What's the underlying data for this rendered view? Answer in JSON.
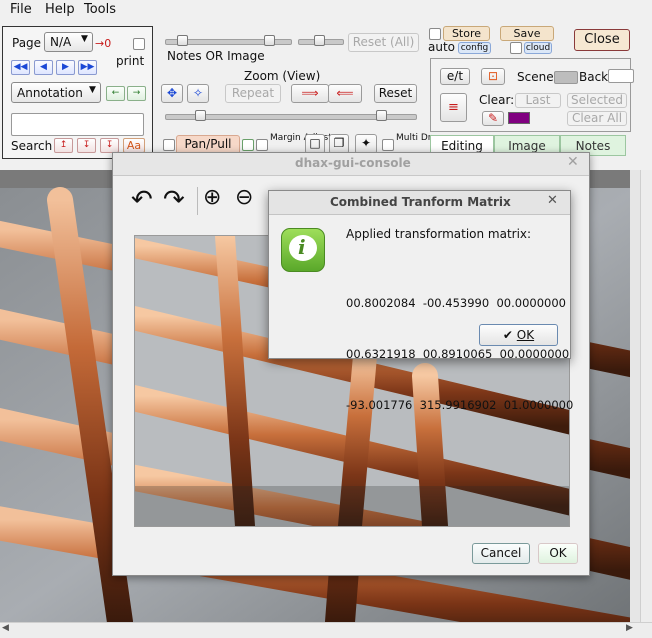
{
  "menubar": {
    "file": "File",
    "help": "Help",
    "tools": "Tools"
  },
  "left_panel": {
    "page_label": "Page",
    "page_select": "N/A",
    "go_zero": "→0",
    "print_label": "print",
    "annotation_select": "Annotation",
    "search_label": "Search",
    "search_value": "",
    "aa_button": "Aa"
  },
  "toolbar": {
    "notes_or_image": "Notes OR Image",
    "reset_all": "Reset (All)",
    "zoom_view": "Zoom (View)",
    "repeat": "Repeat",
    "reset": "Reset",
    "pan_pull": "Pan/Pull",
    "margin_adjust": "Margin Adjust",
    "multi_draw": "Multi Draw"
  },
  "right_top": {
    "store": "Store",
    "save": "Save",
    "close": "Close",
    "auto": "auto",
    "config": "config",
    "cloud": "cloud"
  },
  "right_panel": {
    "et": "e/t",
    "scene": "Scene",
    "back": "Back",
    "clear_label": "Clear:",
    "last": "Last",
    "selected": "Selected",
    "clear_all": "Clear All",
    "swatch_color": "#800080"
  },
  "tabs": [
    {
      "label": "Editing"
    },
    {
      "label": "Image"
    },
    {
      "label": "Notes"
    }
  ],
  "console_window": {
    "title": "dhax-gui-console",
    "cancel": "Cancel",
    "ok": "OK"
  },
  "dialog": {
    "title": "Combined Tranform Matrix",
    "message": "Applied transformation matrix:",
    "rows": [
      "00.8002084  -00.453990  00.0000000",
      "00.6321918  00.8910065  00.0000000",
      "-93.001776  315.9916902  01.0000000"
    ],
    "ok": "OK"
  }
}
